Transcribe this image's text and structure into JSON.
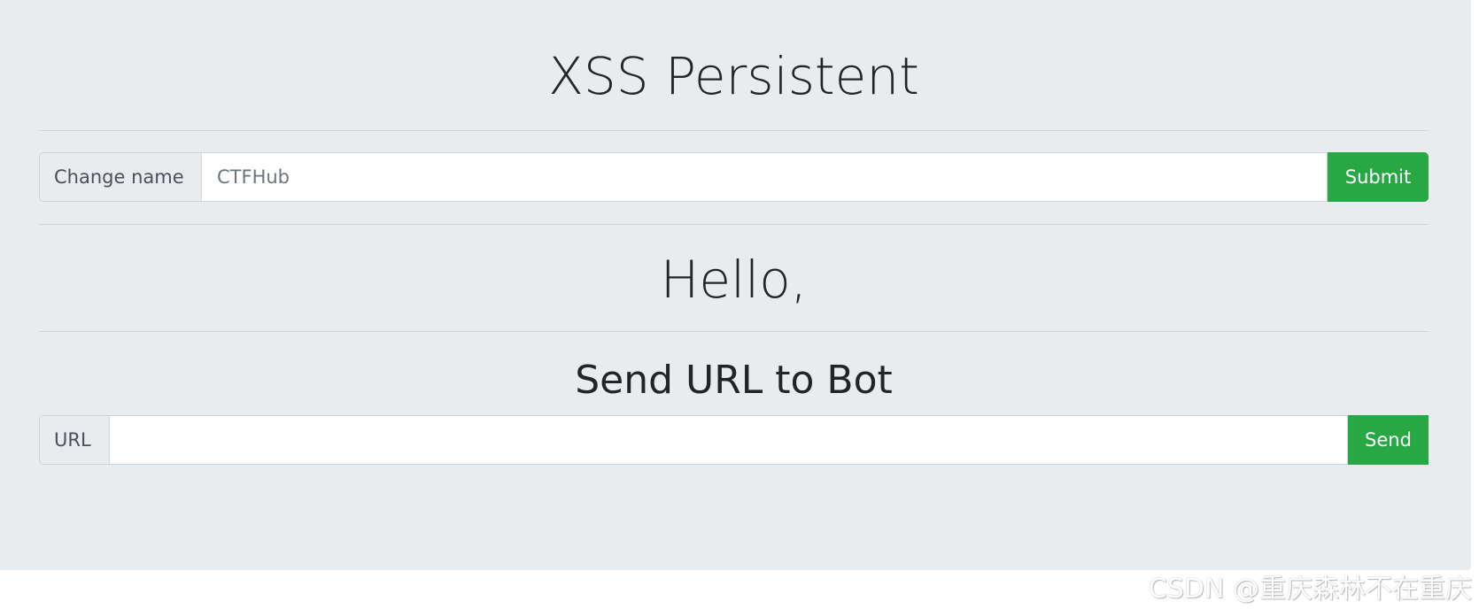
{
  "page": {
    "title": "XSS Persistent",
    "greeting": "Hello,",
    "bot_heading": "Send URL to Bot"
  },
  "change_name": {
    "label": "Change name",
    "value": "CTFHub",
    "button": "Submit"
  },
  "send_url": {
    "label": "URL",
    "value": "",
    "button": "Send"
  },
  "watermark": "CSDN @重庆森林不在重庆",
  "colors": {
    "background": "#e9ecef",
    "button": "#28a745"
  }
}
